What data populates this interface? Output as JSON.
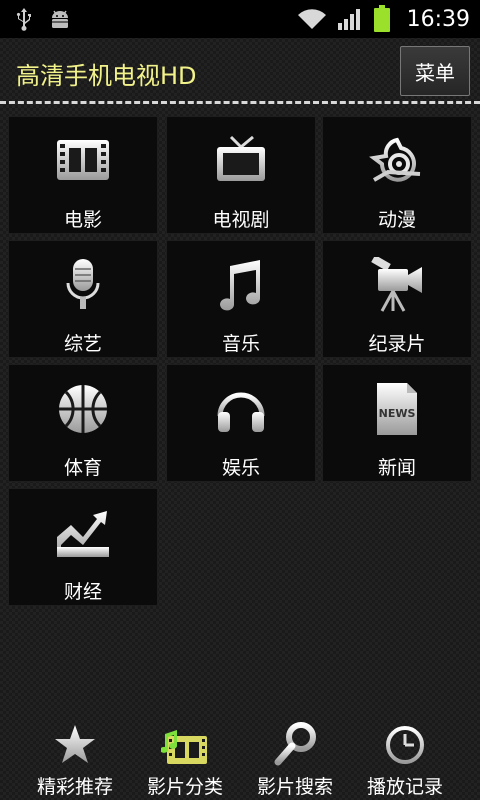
{
  "status_bar": {
    "time": "16:39",
    "icons": [
      "usb-icon",
      "android-debug-icon",
      "wifi-icon",
      "signal-icon",
      "battery-icon"
    ],
    "battery_color": "#9be02a"
  },
  "header": {
    "title": "高清手机电视HD",
    "title_color": "#f2f28a",
    "menu_label": "菜单"
  },
  "categories": [
    {
      "label": "电影",
      "icon": "film-icon"
    },
    {
      "label": "电视剧",
      "icon": "tv-icon"
    },
    {
      "label": "动漫",
      "icon": "anime-icon"
    },
    {
      "label": "综艺",
      "icon": "microphone-icon"
    },
    {
      "label": "音乐",
      "icon": "music-note-icon"
    },
    {
      "label": "纪录片",
      "icon": "video-camera-icon"
    },
    {
      "label": "体育",
      "icon": "basketball-icon"
    },
    {
      "label": "娱乐",
      "icon": "headphones-icon"
    },
    {
      "label": "新闻",
      "icon": "news-icon"
    },
    {
      "label": "财经",
      "icon": "finance-chart-icon"
    }
  ],
  "news_icon_text": "NEWS",
  "tabs": [
    {
      "label": "精彩推荐",
      "icon": "star-icon",
      "active": false
    },
    {
      "label": "影片分类",
      "icon": "film-music-icon",
      "active": true
    },
    {
      "label": "影片搜索",
      "icon": "search-icon",
      "active": false
    },
    {
      "label": "播放记录",
      "icon": "clock-icon",
      "active": false
    }
  ]
}
